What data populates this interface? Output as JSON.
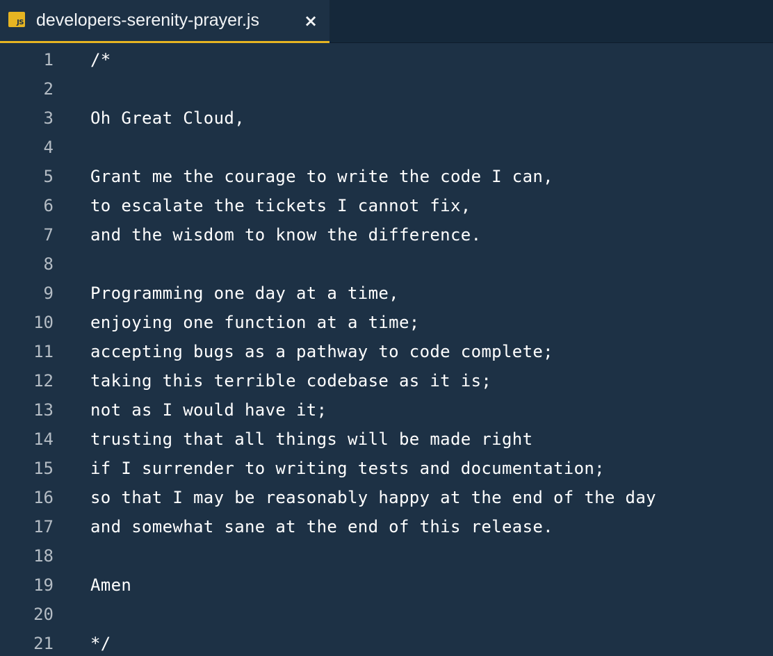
{
  "tab": {
    "icon_label": "JS",
    "icon_name": "javascript-file-icon",
    "title": "developers-serenity-prayer.js",
    "close_glyph": "×",
    "accent_color": "#e6b422"
  },
  "editor": {
    "lines": [
      {
        "num": "1",
        "text": "/*"
      },
      {
        "num": "2",
        "text": ""
      },
      {
        "num": "3",
        "text": "Oh Great Cloud,"
      },
      {
        "num": "4",
        "text": ""
      },
      {
        "num": "5",
        "text": "Grant me the courage to write the code I can,"
      },
      {
        "num": "6",
        "text": "to escalate the tickets I cannot fix,"
      },
      {
        "num": "7",
        "text": "and the wisdom to know the difference."
      },
      {
        "num": "8",
        "text": ""
      },
      {
        "num": "9",
        "text": "Programming one day at a time,"
      },
      {
        "num": "10",
        "text": "enjoying one function at a time;"
      },
      {
        "num": "11",
        "text": "accepting bugs as a pathway to code complete;"
      },
      {
        "num": "12",
        "text": "taking this terrible codebase as it is;"
      },
      {
        "num": "13",
        "text": "not as I would have it;"
      },
      {
        "num": "14",
        "text": "trusting that all things will be made right"
      },
      {
        "num": "15",
        "text": "if I surrender to writing tests and documentation;"
      },
      {
        "num": "16",
        "text": "so that I may be reasonably happy at the end of the day"
      },
      {
        "num": "17",
        "text": "and somewhat sane at the end of this release."
      },
      {
        "num": "18",
        "text": ""
      },
      {
        "num": "19",
        "text": "Amen"
      },
      {
        "num": "20",
        "text": ""
      },
      {
        "num": "21",
        "text": "*/"
      }
    ]
  }
}
